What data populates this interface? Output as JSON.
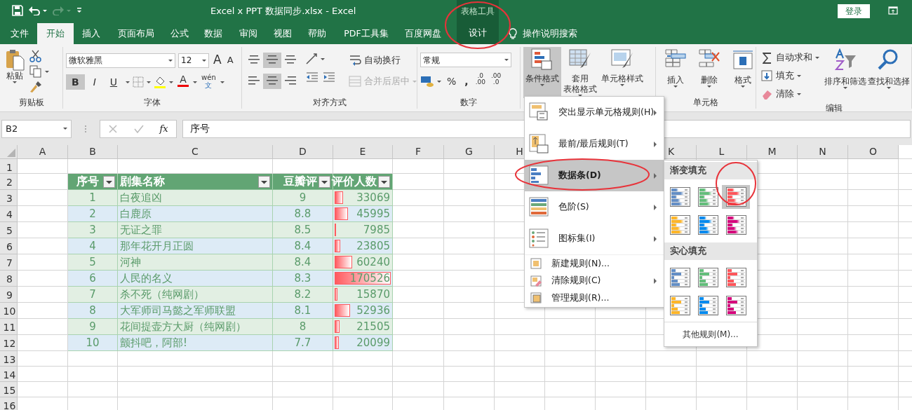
{
  "title_bar": {
    "title": "Excel x PPT 数据同步.xlsx  -  Excel",
    "context_group": "表格工具",
    "sign_in": "登录",
    "redo_disabled": true
  },
  "tabs": [
    {
      "label": "文件",
      "selected": false
    },
    {
      "label": "开始",
      "selected": true
    },
    {
      "label": "插入",
      "selected": false
    },
    {
      "label": "页面布局",
      "selected": false
    },
    {
      "label": "公式",
      "selected": false
    },
    {
      "label": "数据",
      "selected": false
    },
    {
      "label": "审阅",
      "selected": false
    },
    {
      "label": "视图",
      "selected": false
    },
    {
      "label": "帮助",
      "selected": false
    },
    {
      "label": "PDF工具集",
      "selected": false
    },
    {
      "label": "百度网盘",
      "selected": false
    },
    {
      "label": "设计",
      "selected": false,
      "kind": "context"
    }
  ],
  "tell_me": "操作说明搜索",
  "ribbon": {
    "clipboard": {
      "label": "剪贴板",
      "paste": "粘贴"
    },
    "font": {
      "label": "字体",
      "font_name": "微软雅黑",
      "font_size": "12",
      "grow": "A",
      "shrink": "A",
      "bold": "B",
      "italic": "I",
      "underline": "U",
      "font_color": "A",
      "phonetic": [
        "wén",
        "文"
      ],
      "bold_on": true
    },
    "alignment": {
      "label": "对齐方式",
      "wrap_text": "自动换行",
      "merge_center": "合并后居中",
      "merge_disabled": true
    },
    "number": {
      "label": "数字",
      "format": "常规",
      "percent": "%",
      "comma": ",",
      "decimals": [
        [
          ".0",
          ".00"
        ],
        [
          ".00",
          ".0"
        ]
      ]
    },
    "styles": [
      {
        "lines": [
          "条件格式"
        ],
        "selected": true
      },
      {
        "lines": [
          "套用",
          "表格格式"
        ],
        "selected": false
      },
      {
        "lines": [
          "单元格样式"
        ],
        "selected": false
      }
    ],
    "cells": {
      "label": "单元格",
      "buttons": [
        "插入",
        "删除",
        "格式"
      ]
    },
    "editing": {
      "label": "编辑",
      "commands": [
        "自动求和",
        "填充",
        "清除"
      ],
      "buttons": [
        "排序和筛选",
        "查找和选择"
      ]
    }
  },
  "formula_bar": {
    "name_box": "B2",
    "fx": "fx",
    "formula": "序号"
  },
  "sheet": {
    "columns": [
      "A",
      "B",
      "C",
      "D",
      "E",
      "F",
      "G",
      "H",
      "K",
      "L",
      "M",
      "N",
      "O"
    ],
    "rows": [
      "1",
      "2",
      "3",
      "4",
      "5",
      "6",
      "7",
      "8",
      "9",
      "10",
      "11",
      "12",
      "13",
      "14",
      "15",
      "16"
    ],
    "table": {
      "headers": [
        "序号",
        "剧集名称",
        "豆瓣评",
        "评价人数"
      ],
      "rows": [
        {
          "no": "1",
          "name": "白夜追凶",
          "score": "9",
          "votes": "33069",
          "level": 0.19
        },
        {
          "no": "2",
          "name": "白鹿原",
          "score": "8.8",
          "votes": "45995",
          "level": 0.27
        },
        {
          "no": "3",
          "name": "无证之罪",
          "score": "8.5",
          "votes": "7985",
          "level": 0.05
        },
        {
          "no": "4",
          "name": "那年花开月正圆",
          "score": "8.4",
          "votes": "23805",
          "level": 0.14
        },
        {
          "no": "5",
          "name": "河神",
          "score": "8.4",
          "votes": "60240",
          "level": 0.35
        },
        {
          "no": "6",
          "name": "人民的名义",
          "score": "8.3",
          "votes": "170526",
          "level": 1
        },
        {
          "no": "7",
          "name": "杀不死（纯网剧）",
          "score": "8.2",
          "votes": "15870",
          "level": 0.09
        },
        {
          "no": "8",
          "name": "大军师司马懿之军师联盟",
          "score": "8.1",
          "votes": "52936",
          "level": 0.31
        },
        {
          "no": "9",
          "name": "花间提壶方大厨（纯网剧）",
          "score": "8",
          "votes": "21505",
          "level": 0.13
        },
        {
          "no": "10",
          "name": "颤抖吧，阿部!",
          "score": "7.7",
          "votes": "20099",
          "level": 0.12
        }
      ]
    }
  },
  "menu": {
    "items": [
      {
        "kind": "large",
        "label": "突出显示单元格规则(H)",
        "submenu": true,
        "selected": false
      },
      {
        "kind": "large",
        "label": "最前/最后规则(T)",
        "submenu": true,
        "selected": false
      },
      {
        "kind": "large",
        "label": "数据条(D)",
        "submenu": true,
        "selected": true
      },
      {
        "kind": "large",
        "label": "色阶(S)",
        "submenu": true,
        "selected": false
      },
      {
        "kind": "large",
        "label": "图标集(I)",
        "submenu": true,
        "selected": false
      },
      {
        "kind": "small",
        "label": "新建规则(N)...",
        "submenu": false,
        "selected": false
      },
      {
        "kind": "small",
        "label": "清除规则(C)",
        "submenu": true,
        "selected": false
      },
      {
        "kind": "small",
        "label": "管理规则(R)...",
        "submenu": false,
        "selected": false
      }
    ]
  },
  "submenu": {
    "sections": [
      {
        "title": "渐变填充",
        "gradient": true,
        "swatches": [
          {
            "color": "#638ec6",
            "selected": false
          },
          {
            "color": "#63be7b",
            "selected": false
          },
          {
            "color": "#ff555a",
            "selected": true
          },
          {
            "color": "#ffb628",
            "selected": false
          },
          {
            "color": "#008aef",
            "selected": false
          },
          {
            "color": "#d6007b",
            "selected": false
          }
        ]
      },
      {
        "title": "实心填充",
        "gradient": false,
        "swatches": [
          {
            "color": "#638ec6",
            "selected": false
          },
          {
            "color": "#63be7b",
            "selected": false
          },
          {
            "color": "#ff555a",
            "selected": false
          },
          {
            "color": "#ffb628",
            "selected": false
          },
          {
            "color": "#008aef",
            "selected": false
          },
          {
            "color": "#d6007b",
            "selected": false
          }
        ]
      }
    ],
    "footer": "其他规则(M)..."
  }
}
